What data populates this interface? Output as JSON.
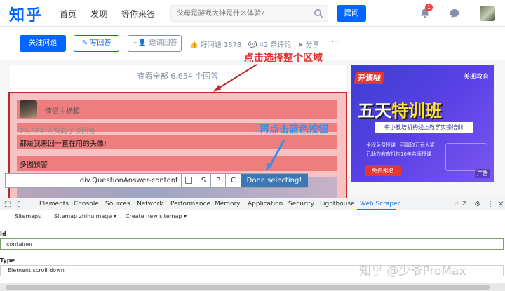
{
  "nav": {
    "logo": "知乎",
    "links": [
      "首页",
      "发现",
      "等你来答"
    ],
    "search_placeholder": "父母是游戏大神是什么体验?",
    "ask_label": "提问",
    "notification_count": "1"
  },
  "question_actions": {
    "follow_label": "关注问题",
    "write_label": "写回答",
    "invite_label": "邀请回答",
    "good_question": "好问题 1878",
    "comments": "42 条评论",
    "share": "分享",
    "more": "···"
  },
  "answers": {
    "header": "查看全部 6,654 个回答",
    "author_name": "情侣中杨超",
    "likes": "24,364 人赞同了该回答",
    "lines": [
      "都是我来回一直在用的头像!",
      "多图预警"
    ]
  },
  "annotations": {
    "red": "点击选择整个区域",
    "blue": "再点击蓝色按钮"
  },
  "selector": {
    "path": "div.QuestionAnswer-content",
    "buttons": [
      "S",
      "P",
      "C"
    ],
    "done_label": "Done selecting!"
  },
  "ad": {
    "tag": "开课啦",
    "brand": "美阅教育",
    "headline_a": "五天",
    "headline_b": "特训班",
    "sub": "中小教培机构线上教学实操培训",
    "bullets": [
      "全程免费授课 · 可赢取万元大奖",
      "已助力教育机构10年名师授课"
    ],
    "cta": "免费报名",
    "label": "广告"
  },
  "devtools": {
    "tabs": [
      "Elements",
      "Console",
      "Sources",
      "Network",
      "Performance",
      "Memory",
      "Application",
      "Security",
      "Lighthouse",
      "Web Scraper"
    ],
    "active_tab": "Web Scraper",
    "warnings": "2"
  },
  "web_scraper": {
    "menu": [
      "Sitemaps",
      "Sitemap zhihuimage",
      "Create new sitemap"
    ],
    "id_label": "Id",
    "id_value": "container",
    "type_label": "Type",
    "type_value": "Element scroll down"
  },
  "watermark": "知乎 @少爷ProMax"
}
